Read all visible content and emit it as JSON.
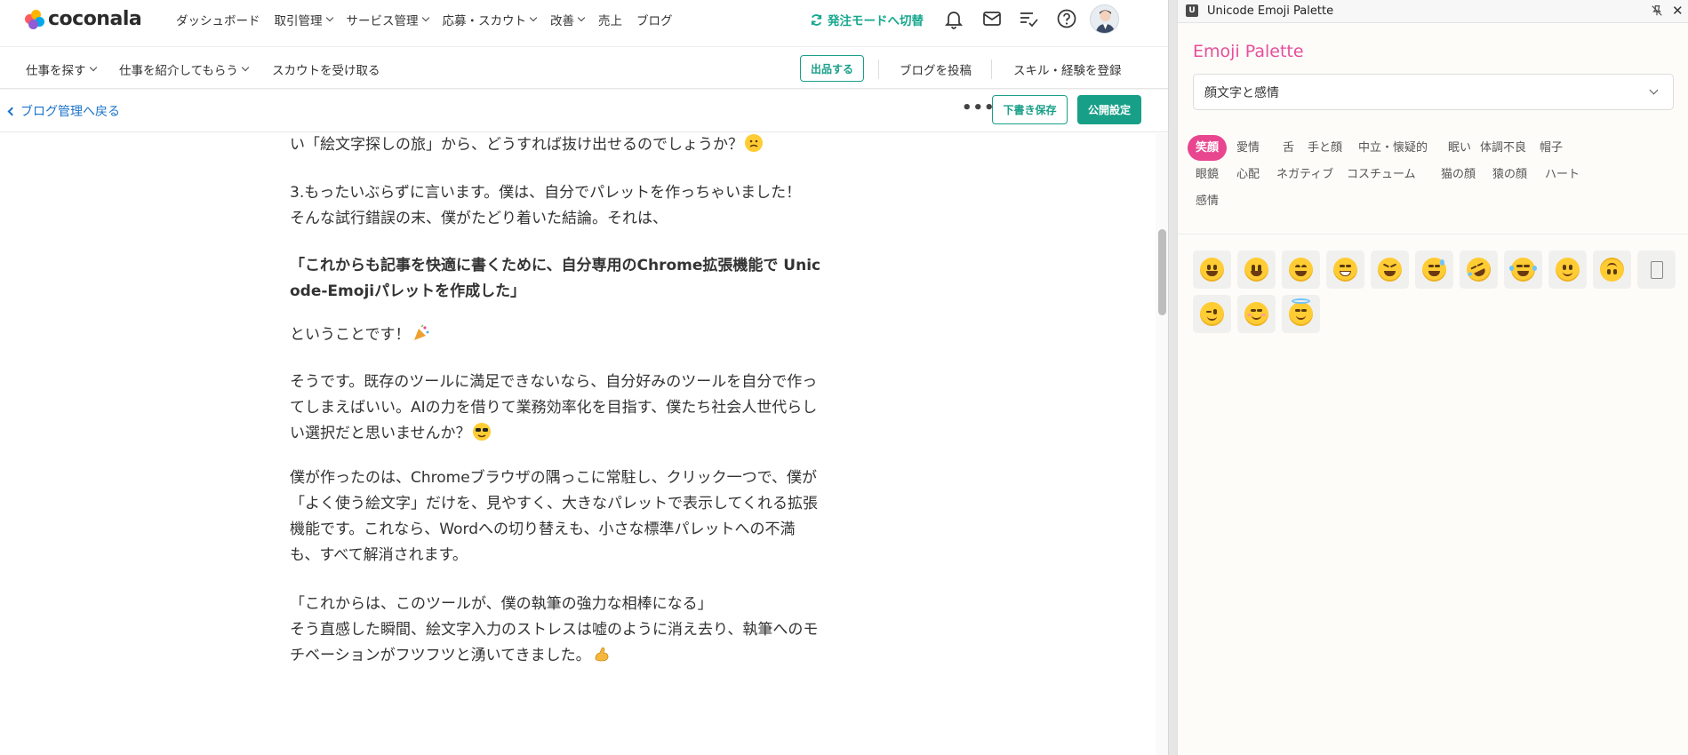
{
  "site": {
    "logo_text": "coconala",
    "nav": [
      "ダッシュボード",
      "取引管理",
      "サービス管理",
      "応募・スカウト",
      "改善",
      "売上",
      "ブログ"
    ],
    "mode_switch": "発注モードへ切替"
  },
  "subnav": {
    "items": [
      "仕事を探す",
      "仕事を紹介してもらう",
      "スカウトを受け取る"
    ],
    "sell_button": "出品する",
    "post_blog": "ブログを投稿",
    "register_skill": "スキル・経験を登録"
  },
  "editor_toolbar": {
    "back_link": "ブログ管理へ戻る",
    "more": "•••",
    "draft_button": "下書き保存",
    "publish_button": "公開設定"
  },
  "article": {
    "p1": "い「絵文字探しの旅」から、どうすれば抜け出せるのでしょうか？",
    "p2a": "3.もったいぶらずに言います。僕は、自分でパレットを作っちゃいました！",
    "p2b": "そんな試行錯誤の末、僕がたどり着いた結論。それは、",
    "p3a": "「これからも記事を快適に書くために、自分専用のChrome拡張機能で Unic",
    "p3b": "ode-Emojiパレットを作成した」",
    "p4": "ということです！",
    "p5a": "そうです。既存のツールに満足できないなら、自分好みのツールを自分で作っ",
    "p5b": "てしまえばいい。AIの力を借りて業務効率化を目指す、僕たち社会人世代らし",
    "p5c": "い選択だと思いませんか？",
    "p6a": "僕が作ったのは、Chromeブラウザの隅っこに常駐し、クリック一つで、僕が",
    "p6b": "「よく使う絵文字」だけを、見やすく、大きなパレットで表示してくれる拡張",
    "p6c": "機能です。これなら、Wordへの切り替えも、小さな標準パレットへの不満",
    "p6d": "も、すべて解消されます。",
    "p7a": "「これからは、このツールが、僕の執筆の強力な相棒になる」",
    "p7b": "そう直感した瞬間、絵文字入力のストレスは嘘のように消え去り、執筆へのモ",
    "p7c": "チベーションがフツフツと湧いてきました。"
  },
  "panel": {
    "window_title": "Unicode Emoji Palette",
    "app_icon_letter": "U",
    "close_glyph": "✕",
    "palette_title": "Emoji Palette",
    "category_selected": "顔文字と感情",
    "subcategories": [
      "笑顔",
      "愛情",
      "舌",
      "手と顔",
      "中立・懐疑的",
      "眠い",
      "体調不良",
      "帽子",
      "眼鏡",
      "心配",
      "ネガティブ",
      "コスチューム",
      "猫の顔",
      "猿の顔",
      "ハート",
      "感情"
    ],
    "active_subcategory": "笑顔",
    "emojis": [
      "grinning-face",
      "grinning-face-big-eyes",
      "grinning-face-smiling-eyes",
      "beaming-face",
      "squinting-face",
      "grinning-face-sweat",
      "rolling-laughing-face",
      "face-tears-of-joy",
      "slightly-smiling-face",
      "upside-down-face",
      "unsupported-glyph",
      "winking-face",
      "smiling-face-smiling-eyes",
      "smiling-face-halo"
    ]
  },
  "colors": {
    "brand_green": "#17a087",
    "link_blue": "#1b73c9",
    "palette_pink": "#e64f9b",
    "active_chip": "#e8468f"
  }
}
